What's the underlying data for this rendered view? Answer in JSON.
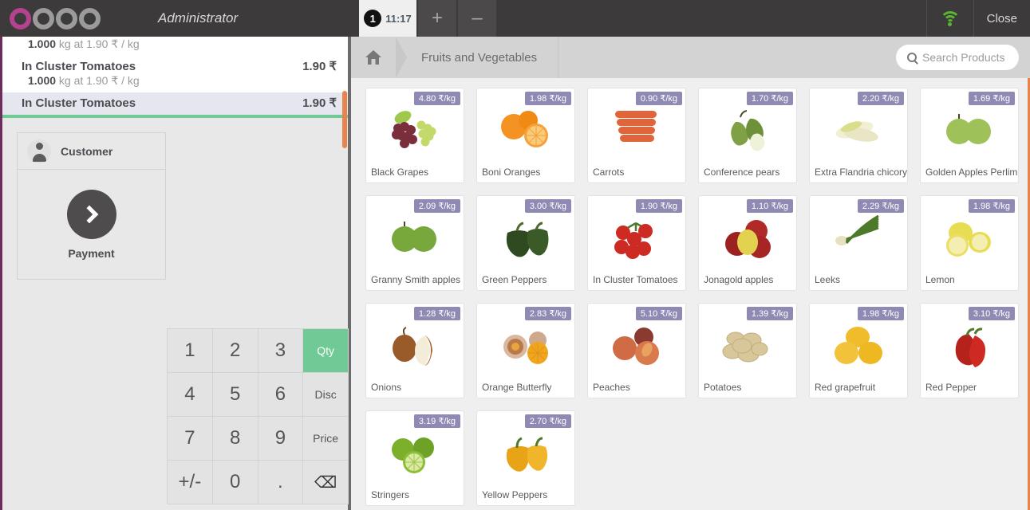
{
  "header": {
    "logo_text": "odoo",
    "user": "Administrator",
    "order_tab": {
      "badge": "1",
      "time": "11:17"
    },
    "add_order_label": "+",
    "remove_order_label": "–",
    "wifi_icon": "wifi-icon",
    "close_label": "Close"
  },
  "order": {
    "lines": [
      {
        "name": "",
        "price": "",
        "detail_qty": "1.000",
        "detail_rest": "kg at 1.90 ₹ / kg",
        "selected": false,
        "partial": true
      },
      {
        "name": "In Cluster Tomatoes",
        "price": "1.90 ₹",
        "detail_qty": "1.000",
        "detail_rest": "kg at 1.90 ₹ / kg",
        "selected": false,
        "partial": false
      },
      {
        "name": "In Cluster Tomatoes",
        "price": "1.90 ₹",
        "detail_qty": "",
        "detail_rest": "",
        "selected": true,
        "partial": false
      }
    ],
    "customer_label": "Customer",
    "payment_label": "Payment"
  },
  "numpad": {
    "keys": [
      {
        "label": "1",
        "type": "digit"
      },
      {
        "label": "2",
        "type": "digit"
      },
      {
        "label": "3",
        "type": "digit"
      },
      {
        "label": "Qty",
        "type": "mode-active"
      },
      {
        "label": "4",
        "type": "digit"
      },
      {
        "label": "5",
        "type": "digit"
      },
      {
        "label": "6",
        "type": "digit"
      },
      {
        "label": "Disc",
        "type": "mode"
      },
      {
        "label": "7",
        "type": "digit"
      },
      {
        "label": "8",
        "type": "digit"
      },
      {
        "label": "9",
        "type": "digit"
      },
      {
        "label": "Price",
        "type": "mode"
      },
      {
        "label": "+/-",
        "type": "digit"
      },
      {
        "label": "0",
        "type": "digit"
      },
      {
        "label": ".",
        "type": "digit"
      },
      {
        "label": "⌫",
        "type": "backspace"
      }
    ]
  },
  "breadcrumb": {
    "home_icon": "home-icon",
    "category": "Fruits and Vegetables"
  },
  "search": {
    "icon": "search-icon",
    "placeholder": "Search Products",
    "value": ""
  },
  "colors": {
    "brand_purple": "#b5428f",
    "topbar": "#3c3a3b",
    "accent_green": "#6fca95",
    "price_badge": "#8e8ab4",
    "scrollbar_orange": "#e8834d",
    "left_edge_purple": "#6e2b5e"
  },
  "products": [
    {
      "name": "Black Grapes",
      "price": "4.80 ₹/kg",
      "art": "grapes"
    },
    {
      "name": "Boni Oranges",
      "price": "1.98 ₹/kg",
      "art": "orange"
    },
    {
      "name": "Carrots",
      "price": "0.90 ₹/kg",
      "art": "carrot"
    },
    {
      "name": "Conference pears",
      "price": "1.70 ₹/kg",
      "art": "pear"
    },
    {
      "name": "Extra Flandria chicory",
      "price": "2.20 ₹/kg",
      "art": "chicory"
    },
    {
      "name": "Golden Apples Perlim",
      "price": "1.69 ₹/kg",
      "art": "goldapple"
    },
    {
      "name": "Granny Smith apples",
      "price": "2.09 ₹/kg",
      "art": "granny"
    },
    {
      "name": "Green Peppers",
      "price": "3.00 ₹/kg",
      "art": "greenpepper"
    },
    {
      "name": "In Cluster Tomatoes",
      "price": "1.90 ₹/kg",
      "art": "tomato"
    },
    {
      "name": "Jonagold apples",
      "price": "1.10 ₹/kg",
      "art": "jonagold"
    },
    {
      "name": "Leeks",
      "price": "2.29 ₹/kg",
      "art": "leek"
    },
    {
      "name": "Lemon",
      "price": "1.98 ₹/kg",
      "art": "lemon"
    },
    {
      "name": "Onions",
      "price": "1.28 ₹/kg",
      "art": "onion"
    },
    {
      "name": "Orange Butterfly",
      "price": "2.83 ₹/kg",
      "art": "butterfly"
    },
    {
      "name": "Peaches",
      "price": "5.10 ₹/kg",
      "art": "peach"
    },
    {
      "name": "Potatoes",
      "price": "1.39 ₹/kg",
      "art": "potato"
    },
    {
      "name": "Red grapefruit",
      "price": "1.98 ₹/kg",
      "art": "grapefruit"
    },
    {
      "name": "Red Pepper",
      "price": "3.10 ₹/kg",
      "art": "redpepper"
    },
    {
      "name": "Stringers",
      "price": "3.19 ₹/kg",
      "art": "lime"
    },
    {
      "name": "Yellow Peppers",
      "price": "2.70 ₹/kg",
      "art": "yellowpepper"
    }
  ]
}
